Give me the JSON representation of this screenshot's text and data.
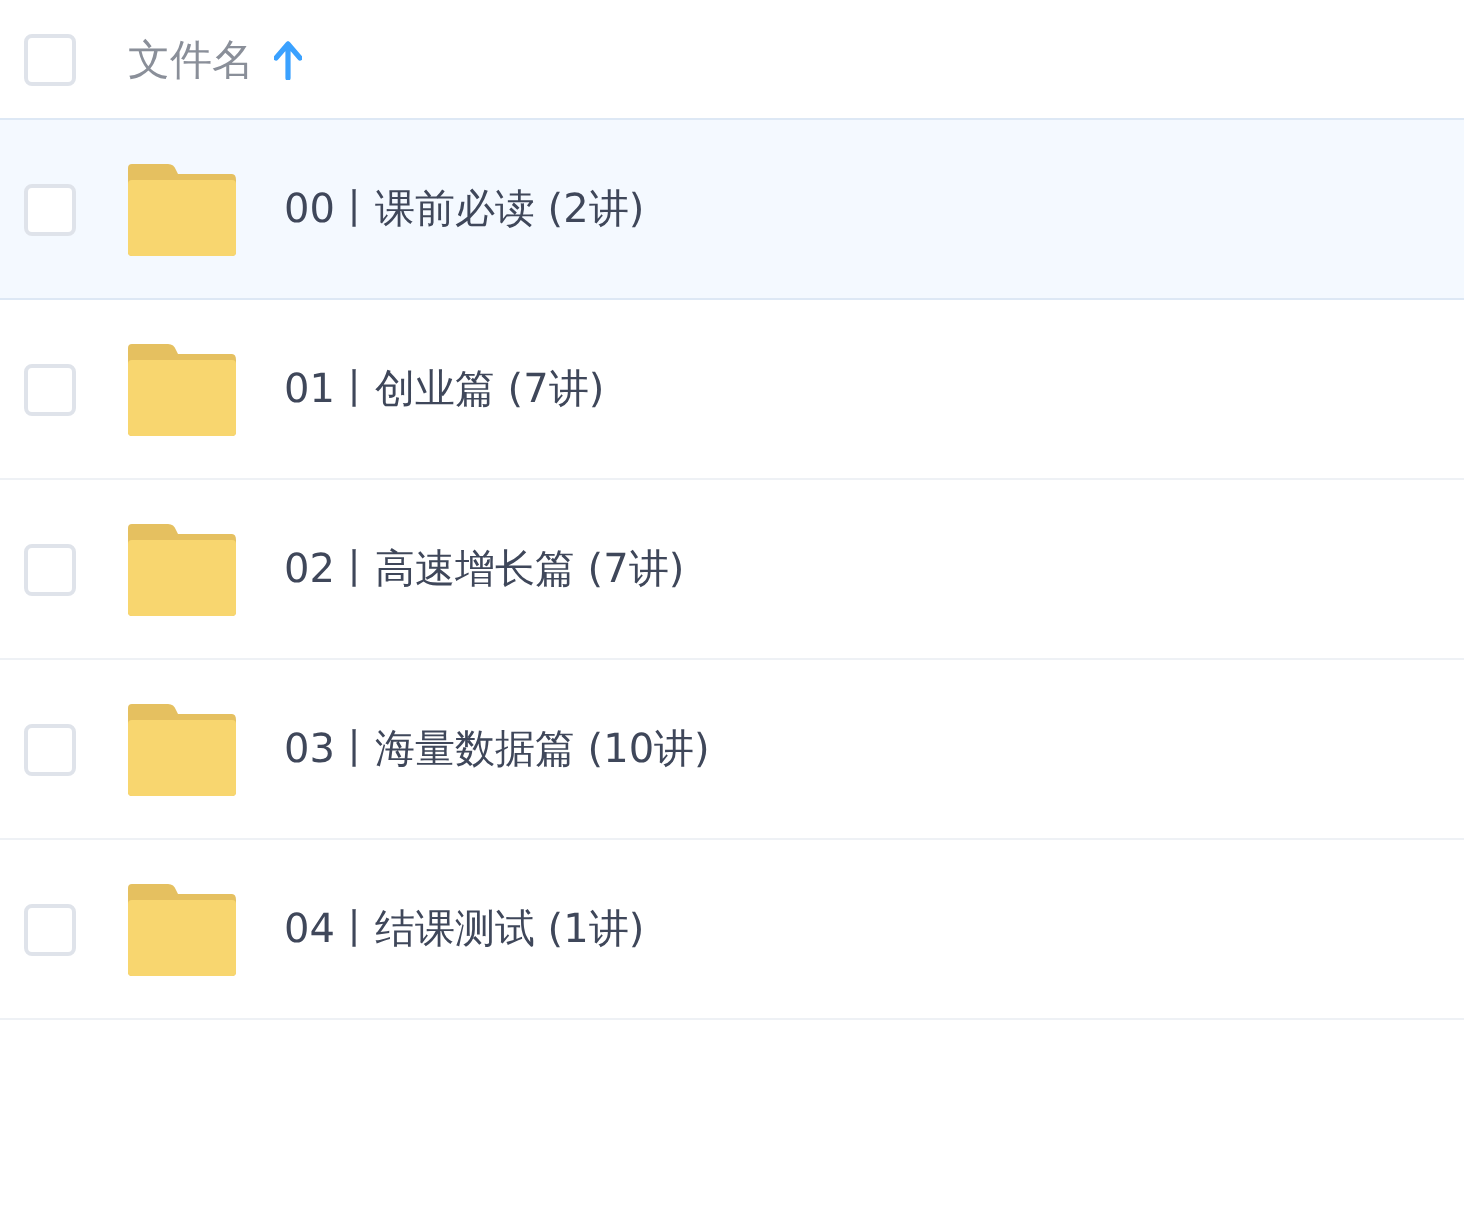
{
  "header": {
    "checked": false,
    "label": "文件名",
    "ascending": true
  },
  "rows": [
    {
      "name": "00丨课前必读 (2讲)",
      "selected": true,
      "checked": false
    },
    {
      "name": "01丨创业篇 (7讲)",
      "selected": false,
      "checked": false
    },
    {
      "name": "02丨高速增长篇 (7讲)",
      "selected": false,
      "checked": false
    },
    {
      "name": "03丨海量数据篇 (10讲)",
      "selected": false,
      "checked": false
    },
    {
      "name": "04丨结课测试 (1讲)",
      "selected": false,
      "checked": false
    }
  ]
}
